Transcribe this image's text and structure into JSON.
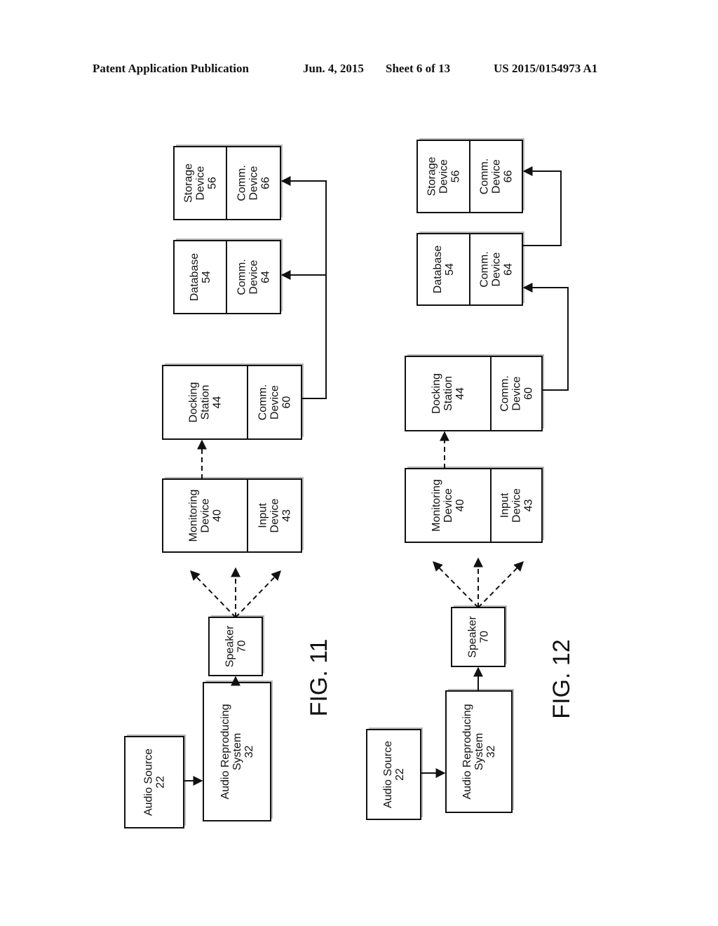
{
  "header": {
    "publication_type": "Patent Application Publication",
    "date": "Jun. 4, 2015",
    "sheet": "Sheet 6 of 13",
    "patent_number": "US 2015/0154973 A1"
  },
  "figures": [
    {
      "label": "FIG. 11",
      "blocks": {
        "audio_source": [
          "Audio Source",
          "22"
        ],
        "audio_reproducing": [
          "Audio Reproducing",
          "System",
          "32"
        ],
        "speaker": [
          "Speaker",
          "70"
        ],
        "monitoring": [
          "Monitoring",
          "Device",
          "40"
        ],
        "input_device": [
          "Input",
          "Device",
          "43"
        ],
        "docking": [
          "Docking",
          "Station",
          "44"
        ],
        "comm_60": [
          "Comm.",
          "Device",
          "60"
        ],
        "database": [
          "Database",
          "54"
        ],
        "comm_64": [
          "Comm.",
          "Device",
          "64"
        ],
        "storage": [
          "Storage",
          "Device",
          "56"
        ],
        "comm_66": [
          "Comm.",
          "Device",
          "66"
        ]
      }
    },
    {
      "label": "FIG. 12",
      "blocks": {
        "audio_source": [
          "Audio Source",
          "22"
        ],
        "audio_reproducing": [
          "Audio Reproducing",
          "System",
          "32"
        ],
        "speaker": [
          "Speaker",
          "70"
        ],
        "monitoring": [
          "Monitoring",
          "Device",
          "40"
        ],
        "input_device": [
          "Input",
          "Device",
          "43"
        ],
        "docking": [
          "Docking",
          "Station",
          "44"
        ],
        "comm_60": [
          "Comm.",
          "Device",
          "60"
        ],
        "database": [
          "Database",
          "54"
        ],
        "comm_64": [
          "Comm.",
          "Device",
          "64"
        ],
        "storage": [
          "Storage",
          "Device",
          "56"
        ],
        "comm_66": [
          "Comm.",
          "Device",
          "66"
        ]
      }
    }
  ]
}
